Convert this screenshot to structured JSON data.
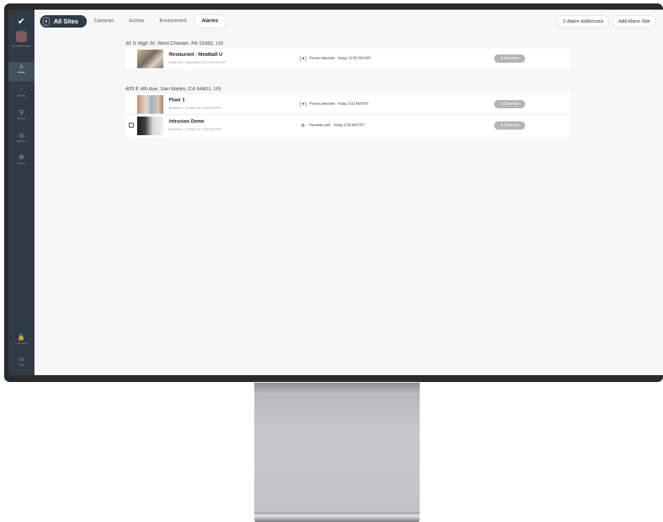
{
  "sidebar": {
    "logo": "✔",
    "org_label": "Verkada Demo",
    "items": [
      {
        "icon": "home-icon",
        "glyph": "⌂",
        "label": "Home",
        "active": true
      },
      {
        "icon": "bell-icon",
        "glyph": "♢",
        "label": "Events",
        "active": false
      },
      {
        "icon": "search-icon",
        "glyph": "⚲",
        "label": "Search",
        "active": false
      },
      {
        "icon": "devices-icon",
        "glyph": "◎",
        "label": "Devices",
        "active": false
      },
      {
        "icon": "gear-icon",
        "glyph": "⚙",
        "label": "Admin",
        "active": false
      }
    ],
    "lockdown": {
      "icon": "lock-icon",
      "glyph": "🔒",
      "label": "Lockdown"
    },
    "help": {
      "icon": "chat-icon",
      "glyph": "▭",
      "label": "Help"
    }
  },
  "topnav": {
    "site_selector": "All Sites",
    "tabs": [
      "Cameras",
      "Access",
      "Environment",
      "Alarms"
    ],
    "active_tab": "Alarms",
    "alarm_addresses_button": "2 Alarm Addresses",
    "add_site_button": "Add Alarm Site"
  },
  "groups": [
    {
      "address": "30 S High St, West Chester, PA 19382, US",
      "rows": [
        {
          "title": "Restaurant - Meatball U",
          "subtitle": "Disarmed · September 20, 1:20 PM EDT",
          "event_icon": "person-detect-icon",
          "event": "Person detected · Today, 12:55 PM EDT",
          "status": "Disarmed",
          "checkbox": false
        }
      ]
    },
    {
      "address": "405 E 4th Ave, San Mateo, CA 94401, US",
      "rows": [
        {
          "title": "Floor 1",
          "subtitle": "Disarmed · October 30, 3:53 PM PDT",
          "event_icon": "person-detect-icon",
          "event": "Person detected · Today, 9:52 AM PDT",
          "status": "Disarmed",
          "checkbox": false
        },
        {
          "title": "Intrusion Demo",
          "subtitle": "Disarmed · October 27, 3:56 PM PDT",
          "event_icon": "humidity-icon",
          "event": "Humidity alert · Today, 6:52 AM PDT",
          "status": "Disarmed",
          "checkbox": true
        }
      ]
    }
  ],
  "colors": {
    "sidebar": "#2f3b46",
    "status_pill": "#b5b5b5",
    "lockdown": "#e05353"
  }
}
